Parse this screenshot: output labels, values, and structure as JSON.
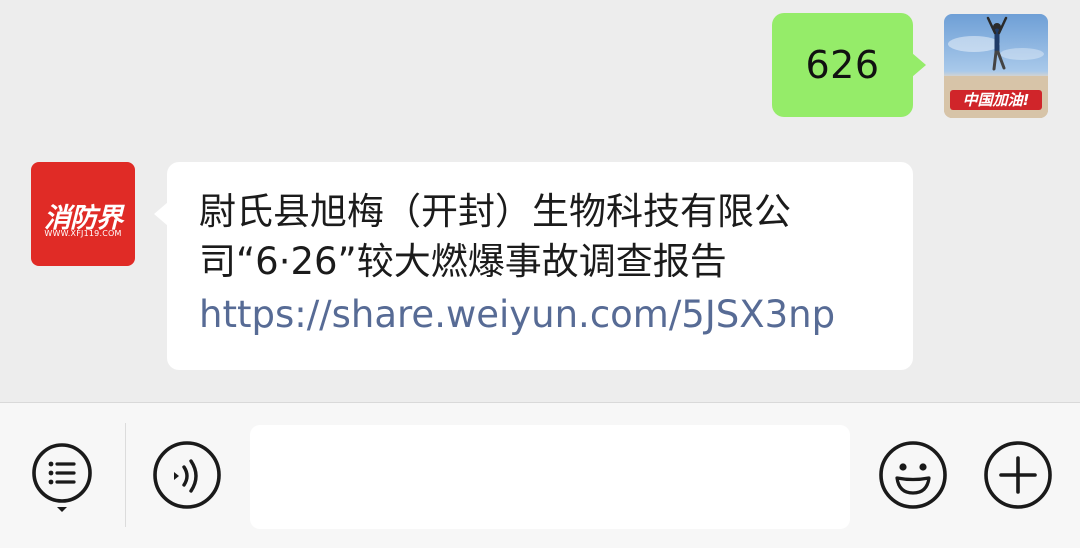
{
  "conversation": {
    "outgoing": {
      "text": "626",
      "avatar_caption": "中国加油!"
    },
    "incoming": {
      "sender_brand": "消防界",
      "sender_site": "WWW.XFJ119.COM",
      "text": "尉氏县旭梅（开封）生物科技有限公司“6·26”较大燃爆事故调查报告",
      "link": "https://share.weiyun.com/5JSX3np"
    }
  },
  "input_bar": {
    "menu_icon": "list-menu-icon",
    "voice_icon": "voice-icon",
    "input_value": "",
    "emoji_icon": "emoji-icon",
    "plus_icon": "plus-icon"
  },
  "colors": {
    "chat_background": "#ededed",
    "outgoing_bubble": "#95ec69",
    "incoming_bubble": "#ffffff",
    "link": "#576b95",
    "sender_avatar": "#e02b26",
    "input_bar": "#f7f7f7"
  }
}
